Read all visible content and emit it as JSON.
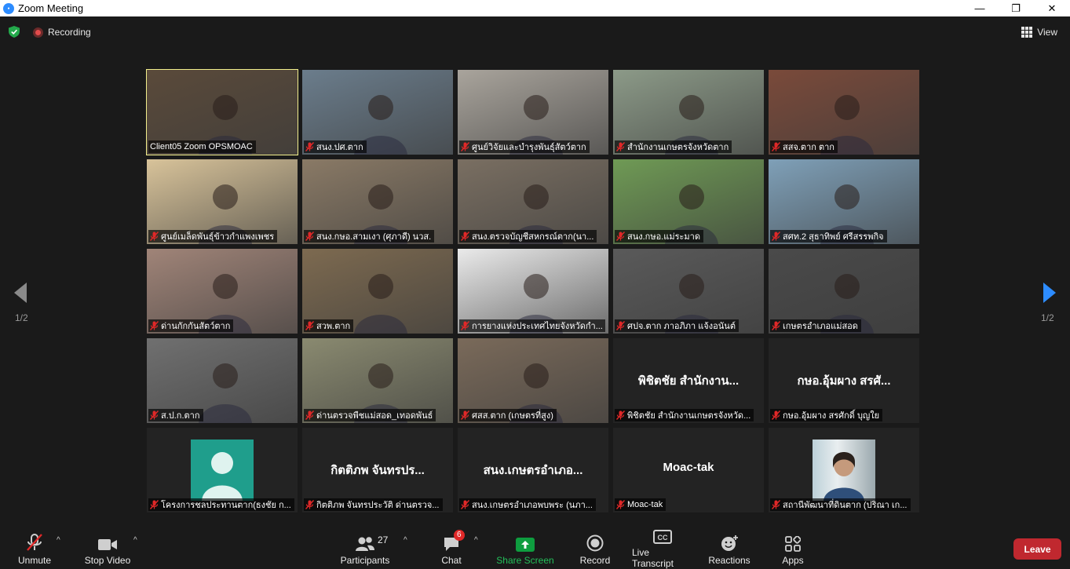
{
  "window": {
    "title": "Zoom Meeting",
    "minimize": "—",
    "maximize": "❐",
    "close": "✕"
  },
  "topbar": {
    "recording": "Recording",
    "view": "View"
  },
  "navigation": {
    "page_left": "1/2",
    "page_right": "1/2"
  },
  "participants": [
    {
      "name": "Client05 Zoom OPSMOAC",
      "active": true,
      "muted": false,
      "video": true,
      "bg": "#5a4a3a"
    },
    {
      "name": "สนง.ปศ.ตาก",
      "muted": true,
      "video": true,
      "bg": "#6b7d8c"
    },
    {
      "name": "ศูนย์วิจัยและบำรุงพันธุ์สัตว์ตาก",
      "muted": true,
      "video": true,
      "bg": "#a9a49c"
    },
    {
      "name": "สำนักงานเกษตรจังหวัดตาก",
      "muted": true,
      "video": true,
      "bg": "#8c9a88"
    },
    {
      "name": "สสจ.ตาก ตาก",
      "muted": true,
      "video": true,
      "bg": "#7a4a3a"
    },
    {
      "name": "ศูนย์เมล็ดพันธุ์ข้าวกำแพงเพชร",
      "muted": true,
      "video": true,
      "bg": "#d8c39a"
    },
    {
      "name": "สนง.กษอ.สามเงา (ศุภาดี) นวส.",
      "muted": true,
      "video": true,
      "bg": "#8a7a66"
    },
    {
      "name": "สนง.ตรวจบัญชีสหกรณ์ตาก(นา...",
      "muted": true,
      "video": true,
      "bg": "#7a6f62"
    },
    {
      "name": "สนง.กษอ.แม่ระมาด",
      "muted": true,
      "video": true,
      "bg": "#6f9a55"
    },
    {
      "name": "สศท.2 สุธาทิพย์ ศรีสรรพกิจ",
      "muted": true,
      "video": true,
      "bg": "#7fa0b8"
    },
    {
      "name": "ด่านกักกันสัตว์ตาก",
      "muted": true,
      "video": true,
      "bg": "#a08478"
    },
    {
      "name": "สวพ.ตาก",
      "muted": true,
      "video": true,
      "bg": "#7d6a50"
    },
    {
      "name": "การยางแห่งประเทศไทยจังหวัดกำ...",
      "muted": true,
      "video": true,
      "bg": "#eaeaea"
    },
    {
      "name": "ศปจ.ตาก ภาอภิภา แจ้งอนันต์",
      "muted": true,
      "video": true,
      "bg": "#5a5a5a"
    },
    {
      "name": "เกษตรอำเภอแม่สอด",
      "muted": true,
      "video": true,
      "bg": "#4a4a4a"
    },
    {
      "name": "ส.ป.ก.ตาก",
      "muted": true,
      "video": true,
      "bg": "#707070"
    },
    {
      "name": "ด่านตรวจพืชแม่สอด_เทอดพันธ์",
      "muted": true,
      "video": true,
      "bg": "#8a8a70"
    },
    {
      "name": "ศสส.ตาก (เกษตรที่สูง)",
      "muted": true,
      "video": true,
      "bg": "#7a6a5a"
    },
    {
      "name": "พิชิตชัย สำนักงานเกษตรจังหวัด...",
      "big": "พิชิตชัย สำนักงาน...",
      "muted": true,
      "video": false
    },
    {
      "name": "กษอ.อุ้มผาง สรศักดิ์ บุญใย",
      "big": "กษอ.อุ้มผาง สรศั...",
      "muted": true,
      "video": false
    },
    {
      "name": "โครงการชลประทานตาก(ธงชัย ก...",
      "muted": true,
      "video": "avatar"
    },
    {
      "name": "กิตติภพ จันทรประวัติ ด่านตรวจ...",
      "big": "กิตติภพ จันทรปร...",
      "muted": true,
      "video": false
    },
    {
      "name": "สนง.เกษตรอำเภอพบพระ (นภา...",
      "big": "สนง.เกษตรอำเภอ...",
      "muted": true,
      "video": false
    },
    {
      "name": "Moac-tak",
      "big": "Moac-tak",
      "muted": true,
      "video": false
    },
    {
      "name": "สถานีพัฒนาที่ดินตาก (ปริณา เก...",
      "muted": true,
      "video": "photo"
    }
  ],
  "toolbar": {
    "unmute": "Unmute",
    "stop_video": "Stop Video",
    "participants": "Participants",
    "participants_count": "27",
    "chat": "Chat",
    "chat_badge": "6",
    "share_screen": "Share Screen",
    "record": "Record",
    "live_transcript": "Live Transcript",
    "reactions": "Reactions",
    "apps": "Apps",
    "leave": "Leave"
  },
  "colors": {
    "active_border": "#f2ef8d",
    "share_green": "#0e9d3f",
    "leave_red": "#c0282f",
    "muted_red": "#e02828",
    "nav_blue": "#2d8cff"
  }
}
